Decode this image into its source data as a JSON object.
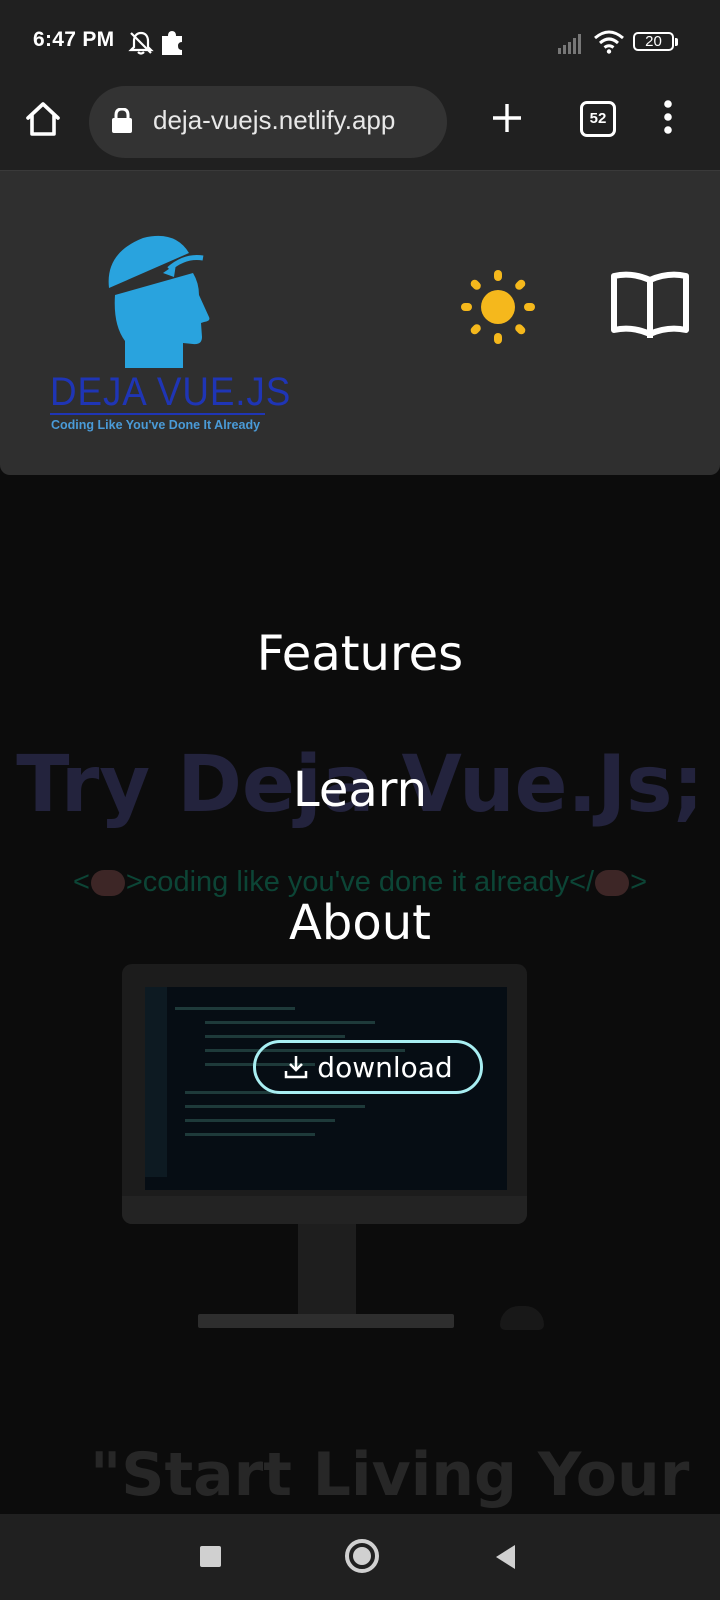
{
  "status_bar": {
    "time": "6:47 PM",
    "battery_level": "20",
    "icons": [
      "bell-off-icon",
      "puzzle-icon",
      "signal-icon",
      "wifi-icon",
      "battery-icon"
    ]
  },
  "browser": {
    "url": "deja-vuejs.netlify.app",
    "tab_count": "52",
    "icons": [
      "home-icon",
      "lock-icon",
      "plus-icon",
      "tabs-icon",
      "more-vert-icon"
    ]
  },
  "header": {
    "logo_wordmark": "DEJA VUE.JS",
    "logo_tagline": "Coding Like You've Done It Already",
    "icons": [
      "sun-icon",
      "book-icon"
    ],
    "colors": {
      "sun": "#f5b81c",
      "logo_head": "#29a3de",
      "wordmark": "#1f35b5"
    }
  },
  "menu": {
    "items": [
      "Features",
      "Learn",
      "About"
    ],
    "download_label": "download",
    "download_border": "#a8eef2"
  },
  "background": {
    "heading": "Try Deja Vue.Js;",
    "tagline_open": "<",
    "tagline_text": ">coding like you've done it already</",
    "tagline_close": ">",
    "quote": "\"Start Living Your"
  },
  "nav_bar": {
    "icons": [
      "recents-square-icon",
      "home-circle-icon",
      "back-triangle-icon"
    ]
  }
}
